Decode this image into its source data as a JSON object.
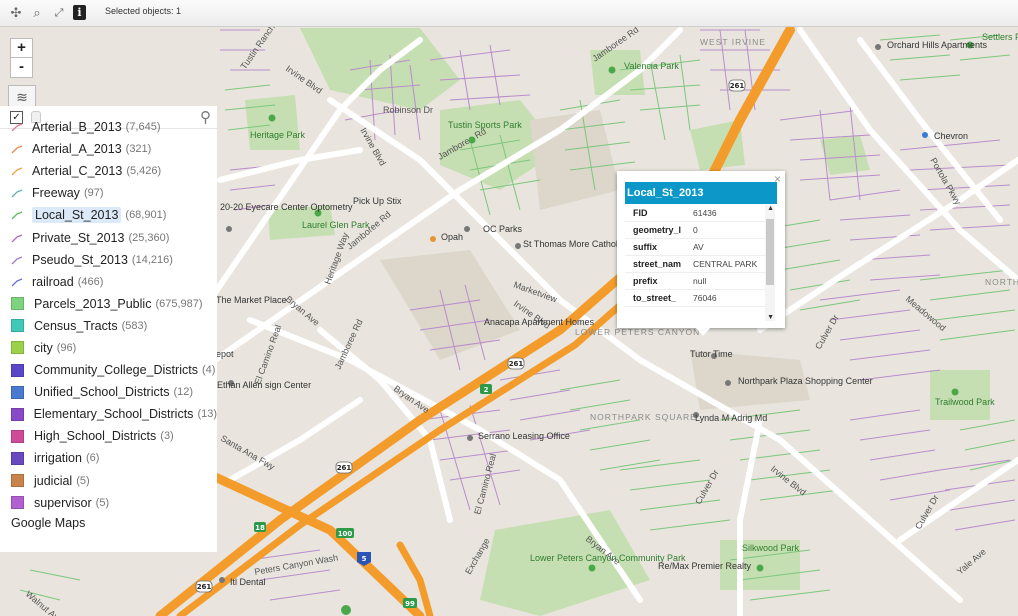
{
  "toolbar": {
    "status": "Selected objects: 1",
    "icons": [
      "pan-icon",
      "zoom-icon",
      "extent-icon",
      "info-icon"
    ]
  },
  "zoom": {
    "in": "+",
    "out": "-"
  },
  "layers": [
    {
      "name": "Arterial_B_2013",
      "count": "(7,645)",
      "type": "line",
      "color": "#e07a8f"
    },
    {
      "name": "Arterial_A_2013",
      "count": "(321)",
      "type": "line",
      "color": "#e88a4a"
    },
    {
      "name": "Arterial_C_2013",
      "count": "(5,426)",
      "type": "line",
      "color": "#f0a040"
    },
    {
      "name": "Freeway",
      "count": "(97)",
      "type": "line",
      "color": "#5fb0b0"
    },
    {
      "name": "Local_St_2013",
      "count": "(68,901)",
      "type": "line",
      "color": "#5ab85a"
    },
    {
      "name": "Private_St_2013",
      "count": "(25,360)",
      "type": "line",
      "color": "#b06ac8"
    },
    {
      "name": "Pseudo_St_2013",
      "count": "(14,216)",
      "type": "line",
      "color": "#9a7ad0"
    },
    {
      "name": "railroad",
      "count": "(466)",
      "type": "line",
      "color": "#6a6ad8"
    },
    {
      "name": "Parcels_2013_Public",
      "count": "(675,987)",
      "type": "box",
      "color": "#7ed37e"
    },
    {
      "name": "Census_Tracts",
      "count": "(583)",
      "type": "box",
      "color": "#40c8b8"
    },
    {
      "name": "city",
      "count": "(96)",
      "type": "box",
      "color": "#9ad24a"
    },
    {
      "name": "Community_College_Districts",
      "count": "(4)",
      "type": "box",
      "color": "#5a48c8"
    },
    {
      "name": "Unified_School_Districts",
      "count": "(12)",
      "type": "box",
      "color": "#4a7ad0"
    },
    {
      "name": "Elementary_School_Districts",
      "count": "(13)",
      "type": "box",
      "color": "#8a4ac8"
    },
    {
      "name": "High_School_Districts",
      "count": "(3)",
      "type": "box",
      "color": "#d04a9a"
    },
    {
      "name": "irrigation",
      "count": "(6)",
      "type": "box",
      "color": "#6a48c0"
    },
    {
      "name": "judicial",
      "count": "(5)",
      "type": "box",
      "color": "#c8844a"
    },
    {
      "name": "supervisor",
      "count": "(5)",
      "type": "box",
      "color": "#b060d0"
    }
  ],
  "selected_layer": "Local_St_2013",
  "basemap_label": "Google Maps",
  "popup": {
    "title": "Local_St_2013",
    "close": "×",
    "rows": [
      {
        "key": "FID",
        "value": "61436"
      },
      {
        "key": "geometry_l",
        "value": "0"
      },
      {
        "key": "suffix",
        "value": "AV"
      },
      {
        "key": "street_nam",
        "value": "CENTRAL PARK"
      },
      {
        "key": "prefix",
        "value": "null"
      },
      {
        "key": "to_street_",
        "value": "76046"
      }
    ]
  },
  "map_labels": {
    "streets": [
      "Irvine Blvd",
      "Jamboree Rd",
      "Tustin Ranch Rd",
      "Bryan Ave",
      "El Camino Real",
      "Culver Dr",
      "Portola Pkwy",
      "Santa Ana Fwy",
      "Walnut Ave",
      "Heritage Way",
      "Robinson Dr",
      "Marketview",
      "Meadowood",
      "Yale Ave",
      "Peters Canyon Wash",
      "Exchange"
    ],
    "places": [
      "WEST IRVINE",
      "LOWER PETERS CANYON",
      "NORTHPARK SQUARE",
      "NORTHWO"
    ],
    "pois": [
      "Orchard Hills Apartments",
      "Valencia Park",
      "Settlers Park",
      "Heritage Park",
      "Tustin Sports Park",
      "Chevron",
      "Pick Up Stix",
      "Laurel Glen Park",
      "OC Parks",
      "St Thomas More Catholic Church",
      "Opah",
      "The Market Place",
      "Anacapa Apartment Homes",
      "Tutor Time",
      "Northpark Plaza Shopping Center",
      "Lynda M Adrig Md",
      "Trailwood Park",
      "Ethan Allen sign Center",
      "Serrano Leasing Office",
      "Lower Peters Canyon Community Park",
      "Silkwood Park",
      "Re/Max Premier Realty",
      "Itl Dental",
      "20-20 Eyecare Center Optometry",
      "epot"
    ],
    "shields": [
      "261",
      "261",
      "261",
      "261",
      "2",
      "100",
      "5",
      "18",
      "99"
    ]
  }
}
